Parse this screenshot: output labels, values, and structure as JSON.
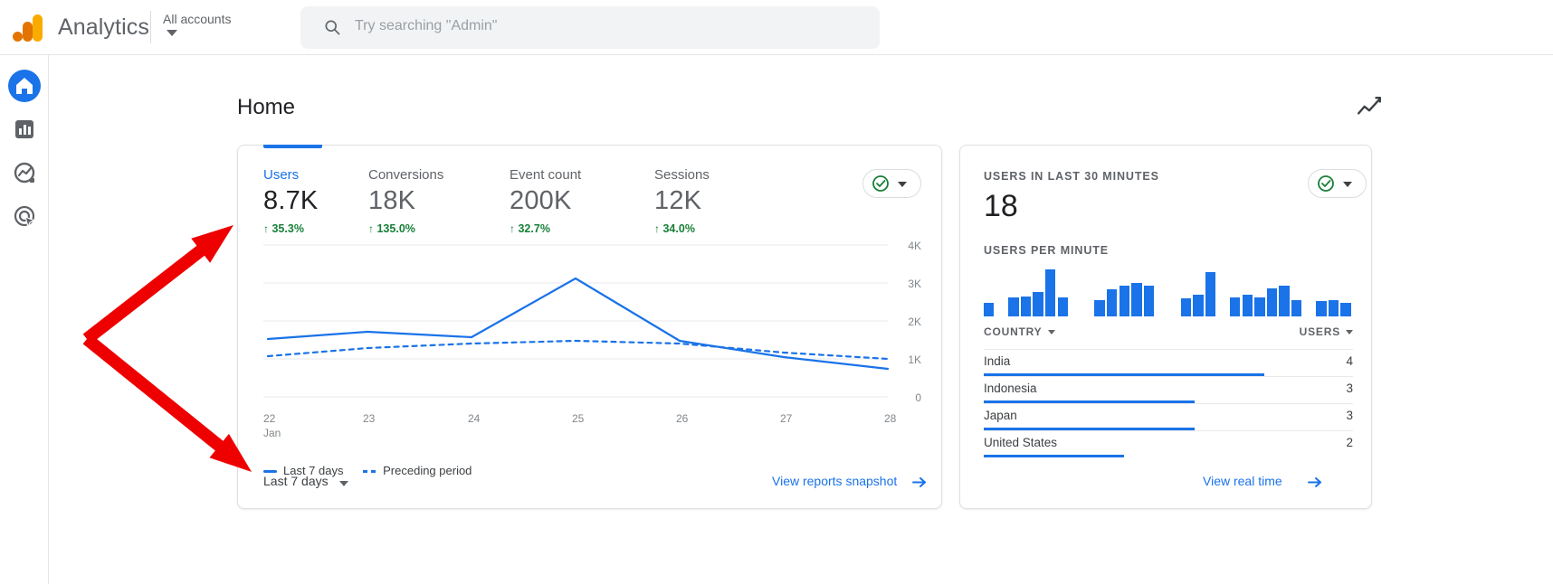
{
  "header": {
    "brand": "Analytics",
    "account_selector": "All accounts",
    "logo_icon": "analytics-logo-icon",
    "search": {
      "icon": "search-icon",
      "placeholder": "Try searching \"Admin\"",
      "value": ""
    }
  },
  "sidebar": {
    "items": [
      {
        "name": "home",
        "icon": "home-icon",
        "active": true
      },
      {
        "name": "reports",
        "icon": "bar-chart-icon",
        "active": false
      },
      {
        "name": "explore",
        "icon": "explore-icon",
        "active": false
      },
      {
        "name": "advertising",
        "icon": "advertising-target-icon",
        "active": false
      }
    ]
  },
  "page": {
    "title": "Home",
    "trend_icon": "insights-trend-icon"
  },
  "main_card": {
    "badge": {
      "check_icon": "check-circle-icon",
      "caret_icon": "chevron-down-icon"
    },
    "metrics": [
      {
        "label": "Users",
        "value": "8.7K",
        "delta": "35.3%",
        "arrow": "↑",
        "active": true
      },
      {
        "label": "Conversions",
        "value": "18K",
        "delta": "135.0%",
        "arrow": "↑",
        "active": false
      },
      {
        "label": "Event count",
        "value": "200K",
        "delta": "32.7%",
        "arrow": "↑",
        "active": false
      },
      {
        "label": "Sessions",
        "value": "12K",
        "delta": "34.0%",
        "arrow": "↑",
        "active": false
      }
    ],
    "legend": [
      {
        "label": "Last 7 days",
        "style": "solid"
      },
      {
        "label": "Preceding period",
        "style": "dashed"
      }
    ],
    "date_range": "Last 7 days",
    "date_range_caret": "chevron-down-icon",
    "footer_link": "View reports snapshot",
    "footer_link_icon": "arrow-right-icon"
  },
  "realtime_card": {
    "badge": {
      "check_icon": "check-circle-icon",
      "caret_icon": "chevron-down-icon"
    },
    "users_30min_label": "USERS IN LAST 30 MINUTES",
    "users_30min_value": "18",
    "users_per_minute_label": "USERS PER MINUTE",
    "users_per_minute": [
      22,
      0,
      30,
      32,
      38,
      74,
      30,
      0,
      0,
      26,
      42,
      48,
      52,
      48,
      0,
      0,
      28,
      34,
      70,
      0,
      30,
      34,
      30,
      44,
      48,
      26,
      0,
      24,
      26,
      22
    ],
    "table": {
      "columns": [
        "COUNTRY",
        "USERS"
      ],
      "column_caret": "chevron-down-icon",
      "rows": [
        {
          "country": "India",
          "users": "4",
          "bar_pct": 76
        },
        {
          "country": "Indonesia",
          "users": "3",
          "bar_pct": 57
        },
        {
          "country": "Japan",
          "users": "3",
          "bar_pct": 57
        },
        {
          "country": "United States",
          "users": "2",
          "bar_pct": 38
        }
      ]
    },
    "footer_link": "View real time",
    "footer_link_icon": "arrow-right-icon"
  },
  "chart_data": {
    "type": "line",
    "title": "",
    "xlabel": "",
    "ylabel": "",
    "x": [
      "22",
      "23",
      "24",
      "25",
      "26",
      "27",
      "28"
    ],
    "x_axis_note": "Jan",
    "ylim": [
      0,
      4000
    ],
    "yticks": [
      0,
      1000,
      2000,
      3000,
      4000
    ],
    "ytick_labels": [
      "0",
      "1K",
      "2K",
      "3K",
      "4K"
    ],
    "grid": true,
    "legend_position": "bottom-left",
    "series": [
      {
        "name": "Last 7 days",
        "style": "solid",
        "color": "#1a73e8",
        "values": [
          1520,
          1700,
          1580,
          3280,
          1490,
          1180,
          880
        ]
      },
      {
        "name": "Preceding period",
        "style": "dashed",
        "color": "#1a73e8",
        "values": [
          1080,
          1300,
          1400,
          1470,
          1400,
          1180,
          1020
        ]
      }
    ]
  },
  "annotations": {
    "arrow_color": "#ee0000",
    "arrows": [
      {
        "name": "arrow-to-chart",
        "from": [
          96,
          375
        ],
        "to": [
          258,
          249
        ]
      },
      {
        "name": "arrow-to-date-range",
        "from": [
          96,
          375
        ],
        "to": [
          278,
          522
        ]
      }
    ]
  }
}
